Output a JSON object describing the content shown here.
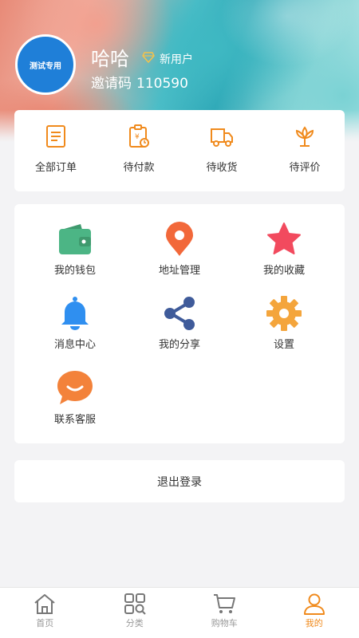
{
  "profile": {
    "avatar_text": "测试专用",
    "username": "哈哈",
    "level_label": "新用户",
    "invite_label": "邀请码",
    "invite_code": "110590"
  },
  "orders": {
    "items": [
      {
        "label": "全部订单",
        "icon": "order-list-icon"
      },
      {
        "label": "待付款",
        "icon": "pending-payment-icon"
      },
      {
        "label": "待收货",
        "icon": "delivery-truck-icon"
      },
      {
        "label": "待评价",
        "icon": "review-flower-icon"
      }
    ]
  },
  "services": {
    "items": [
      {
        "label": "我的钱包",
        "icon": "wallet-icon"
      },
      {
        "label": "地址管理",
        "icon": "location-pin-icon"
      },
      {
        "label": "我的收藏",
        "icon": "star-icon"
      },
      {
        "label": "消息中心",
        "icon": "bell-icon"
      },
      {
        "label": "我的分享",
        "icon": "share-icon"
      },
      {
        "label": "设置",
        "icon": "gear-icon"
      },
      {
        "label": "联系客服",
        "icon": "chat-bubble-icon"
      }
    ]
  },
  "logout": {
    "label": "退出登录"
  },
  "tabbar": {
    "items": [
      {
        "label": "首页",
        "icon": "home-icon"
      },
      {
        "label": "分类",
        "icon": "category-icon"
      },
      {
        "label": "购物车",
        "icon": "cart-icon"
      },
      {
        "label": "我的",
        "icon": "user-icon"
      }
    ],
    "active_index": 3
  },
  "colors": {
    "accent": "#f08a1c",
    "avatar_bg": "#1f7fd8",
    "wallet": "#4cb585",
    "pin": "#f2683a",
    "star": "#f24a5e",
    "bell": "#2f8ff0",
    "share": "#3f5b9a",
    "gear": "#f4a53c",
    "chat": "#f3823a"
  }
}
